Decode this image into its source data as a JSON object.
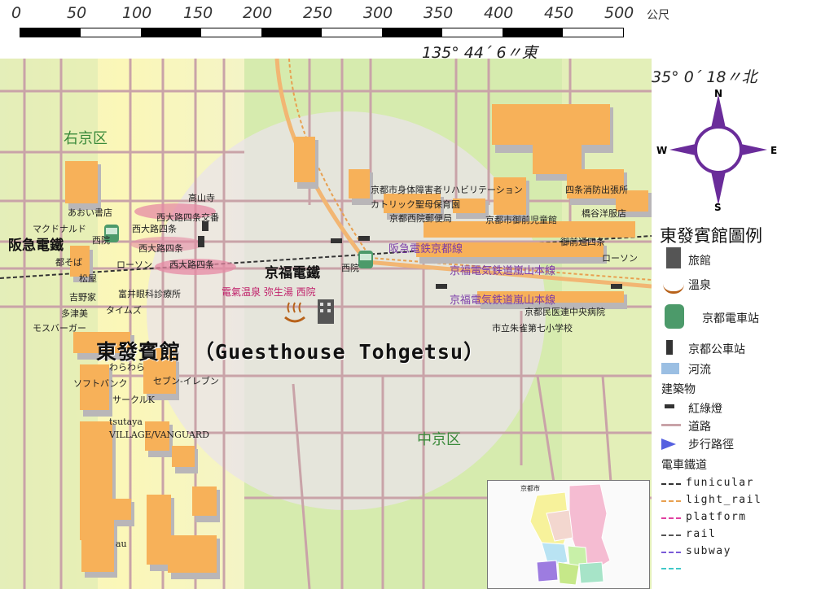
{
  "scale": {
    "ticks": [
      "0",
      "50",
      "100",
      "150",
      "200",
      "250",
      "300",
      "350",
      "400",
      "450",
      "500"
    ],
    "unit": "公尺"
  },
  "coords": {
    "longitude": "135° 44´ 6〃東",
    "latitude": "35° 0´ 18〃北"
  },
  "compass": {
    "n": "N",
    "s": "S",
    "e": "E",
    "w": "W"
  },
  "wards": {
    "ukyo": "右京区",
    "nakagyo": "中京区"
  },
  "stations": {
    "hankyu": "阪急電鐵",
    "keifuku": "京福電鐵",
    "nishi_in_1": "西院",
    "nishi_in_2": "西院"
  },
  "title": "東發賓館 （Guesthouse Tohgetsu）",
  "lines": {
    "hankyu_kyoto": "阪急電鉄京都線",
    "keifuku_1": "京福電気鉄道嵐山本線",
    "keifuku_2": "京福電気鉄道嵐山本線"
  },
  "onsen": "電氣温泉 弥生湯 西院",
  "places": {
    "takayamadera": "高山寺",
    "nishioji_shijo_kosaban": "西大路四条交番",
    "aoi_shoten": "あおい書店",
    "mcdonalds": "マクドナルド",
    "nishioji_shijo_1": "西大路四条",
    "nishioji_shijo_2": "西大路四条",
    "nishioji_shijo_3": "西大路四条",
    "miyako_soba": "都そば",
    "lawson_1": "ローソン",
    "matsuya": "松屋",
    "yoshinoya": "吉野家",
    "tominokai": "富井眼科診療所",
    "tatsumi": "多津美",
    "times": "タイムズ",
    "mos": "モスバーガー",
    "warawara": "わらわら",
    "softbank": "ソフトバンク",
    "seven": "セブン-イレブン",
    "circlek": "サークルK",
    "tsutaya": "tsutaya",
    "village": "VILLAGE/VANGUARD",
    "au": "au",
    "rehab": "京都市身体障害者リハビリテーション",
    "fire": "四条消防出張所",
    "catholic": "カトリック聖母保育園",
    "post": "京都西院郵便局",
    "children": "京都市御前児童館",
    "hashitani": "橋谷洋服店",
    "omae": "御前通四条",
    "lawson_2": "ローソン",
    "hospital": "京都民医連中央病院",
    "school": "市立朱雀第七小学校"
  },
  "legend": {
    "title": "東發賓館圖例",
    "hotel": "旅館",
    "onsen": "溫泉",
    "train": "京都電車站",
    "bus": "京都公車站",
    "river": "河流",
    "building": "建築物",
    "signal": "紅綠燈",
    "road": "道路",
    "walk": "步行路徑",
    "rail_title": "電車鐵道",
    "funicular": "funicular",
    "light_rail": "light_rail",
    "platform": "platform",
    "rail": "rail",
    "subway": "subway"
  },
  "inset": {
    "label": "京都市"
  },
  "colors": {
    "map_bg": "#d9ecb0",
    "yellow_band": "#fbf6b8",
    "road": "#c9a3a8",
    "building_top": "#f7b159",
    "building_side": "#b9b6b8",
    "walk_circle": "#e6e0ec",
    "purple": "#7a3aa8",
    "compass": "#6a2c9a"
  }
}
